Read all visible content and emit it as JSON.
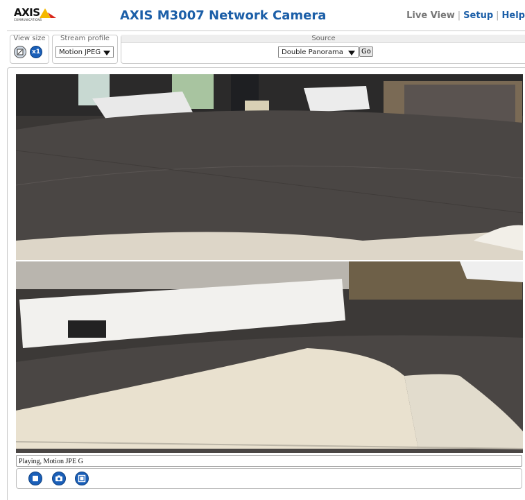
{
  "header": {
    "logo_text": "AXIS",
    "logo_subtext": "COMMUNICATIONS",
    "title": "AXIS M3007 Network Camera",
    "nav": {
      "live_view": "Live View",
      "separator": "|",
      "setup": "Setup",
      "help": "Help"
    }
  },
  "toolbar": {
    "view_size": {
      "label": "View size",
      "buttons": [
        "fit-icon",
        "x1-icon"
      ],
      "x1_text": "x1"
    },
    "stream_profile": {
      "label": "Stream profile",
      "value": "Motion JPEG"
    },
    "source": {
      "label": "Source",
      "value": "Double Panorama",
      "go_label": "Go"
    }
  },
  "video": {
    "status_text": "Playing, Motion JPE G",
    "controls": [
      "stop-icon",
      "snapshot-icon",
      "fullscreen-icon"
    ]
  },
  "colors": {
    "brand_blue": "#1c5fa8",
    "button_blue": "#1a5fb8",
    "logo_yellow": "#f5b800",
    "logo_red": "#d9261c"
  }
}
